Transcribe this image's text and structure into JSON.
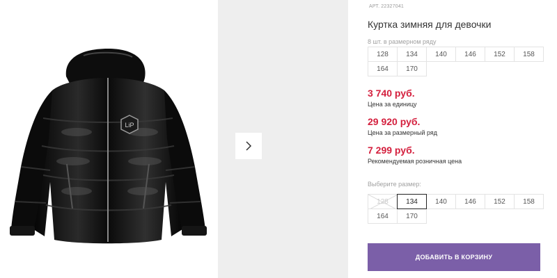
{
  "product": {
    "sku_label": "АРТ.",
    "sku_value": "22327041",
    "title": "Куртка зимняя для девочки",
    "row_hint": "8 шт. в размерном ряду",
    "row_sizes": [
      "128",
      "134",
      "140",
      "146",
      "152",
      "158",
      "164",
      "170"
    ],
    "prices": [
      {
        "value": "3 740 руб.",
        "note": "Цена за единицу"
      },
      {
        "value": "29 920 руб.",
        "note": "Цена за размерный ряд"
      },
      {
        "value": "7 299 руб.",
        "note": "Рекомендуемая розничная цена"
      }
    ],
    "choose_label": "Выберите размер:",
    "select_sizes": [
      {
        "label": "128",
        "state": "disabled"
      },
      {
        "label": "134",
        "state": "selected"
      },
      {
        "label": "140",
        "state": "available"
      },
      {
        "label": "146",
        "state": "available"
      },
      {
        "label": "152",
        "state": "available"
      },
      {
        "label": "158",
        "state": "available"
      },
      {
        "label": "164",
        "state": "available"
      },
      {
        "label": "170",
        "state": "available"
      }
    ],
    "cart_button": "ДОБАВИТЬ В КОРЗИНУ"
  },
  "gallery": {
    "next_icon": "chevron-right-icon",
    "logo_text": "LiP"
  },
  "colors": {
    "price": "#d4203e",
    "button": "#7b5fa8",
    "side_panel": "#eeeeee"
  }
}
